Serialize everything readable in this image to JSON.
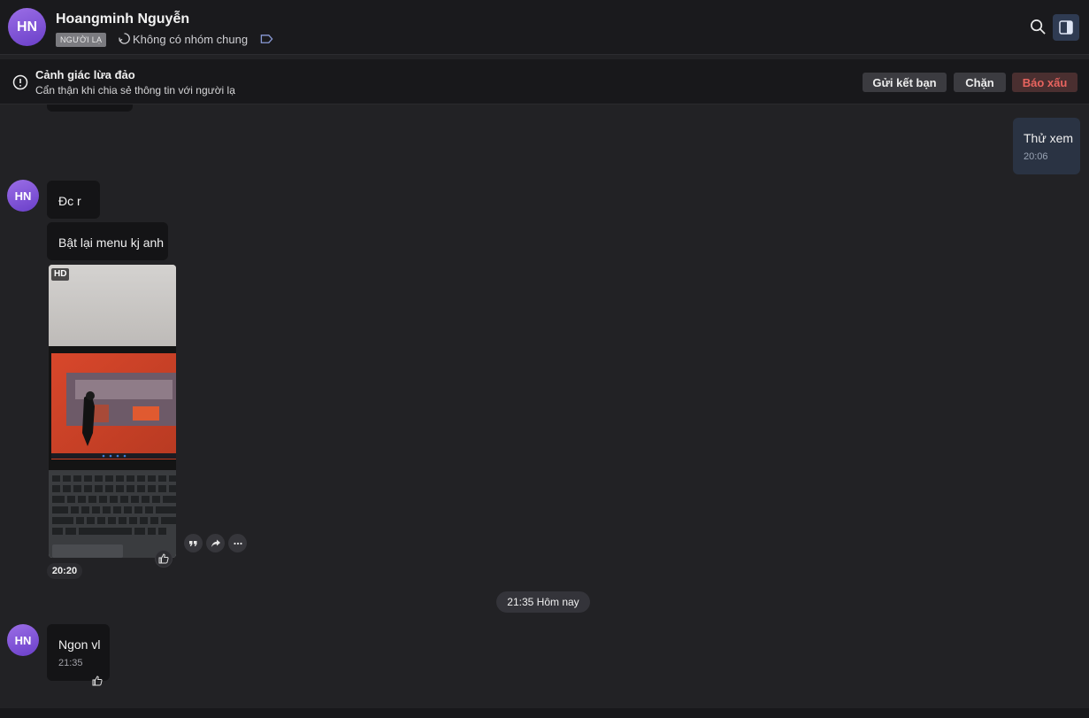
{
  "header": {
    "avatar_initials": "HN",
    "contact_name": "Hoangminh Nguyễn",
    "stranger_badge": "NGƯỜI LẠ",
    "common_groups": "Không có nhóm chung",
    "accent_color": "#7b4fd6"
  },
  "warning": {
    "title": "Cảnh giác lừa đảo",
    "subtitle": "Cẩn thận khi chia sẻ thông tin với người lạ",
    "add_friend_label": "Gửi kết bạn",
    "block_label": "Chặn",
    "report_label": "Báo xấu",
    "report_color": "#e8645f"
  },
  "messages": {
    "outgoing_1": {
      "text": "Thử xem",
      "time": "20:06"
    },
    "incoming_1": {
      "avatar": "HN",
      "text": "Đc r"
    },
    "incoming_2": {
      "text": "Bật lại menu kj anh"
    },
    "incoming_photo": {
      "badge": "HD",
      "time": "20:20"
    },
    "date_divider": "21:35 Hôm nay",
    "incoming_3": {
      "avatar": "HN",
      "text": "Ngon vl",
      "time": "21:35"
    }
  },
  "icons": {
    "search": "search-icon",
    "panel": "sidebar-panel-icon",
    "warning": "alert-circle-icon",
    "like": "thumbs-up-icon",
    "quote": "quote-icon",
    "share": "share-icon",
    "more": "more-icon"
  }
}
